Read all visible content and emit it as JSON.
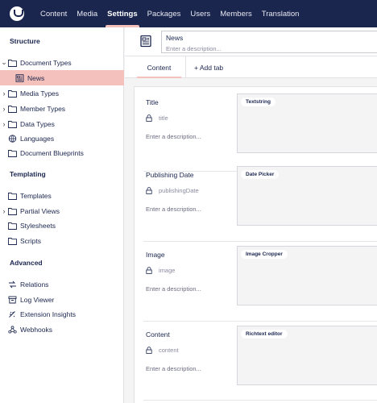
{
  "topbar": {
    "nav": [
      "Content",
      "Media",
      "Settings",
      "Packages",
      "Users",
      "Members",
      "Translation"
    ],
    "active": "Settings"
  },
  "sidebar": {
    "sections": [
      {
        "title": "Structure"
      },
      {
        "title": "Templating"
      },
      {
        "title": "Advanced"
      }
    ],
    "items": [
      {
        "label": "Document Types",
        "icon": "folder-icon",
        "caret": "expanded"
      },
      {
        "label": "News",
        "icon": "newspaper-icon",
        "active": true
      },
      {
        "label": "Media Types",
        "icon": "folder-icon",
        "caret": "collapsed"
      },
      {
        "label": "Member Types",
        "icon": "folder-icon",
        "caret": "collapsed"
      },
      {
        "label": "Data Types",
        "icon": "folder-icon",
        "caret": "collapsed"
      },
      {
        "label": "Languages",
        "icon": "globe-icon"
      },
      {
        "label": "Document Blueprints",
        "icon": "folder-icon"
      },
      {
        "label": "Templates",
        "icon": "folder-icon"
      },
      {
        "label": "Partial Views",
        "icon": "folder-icon",
        "caret": "collapsed"
      },
      {
        "label": "Stylesheets",
        "icon": "folder-icon"
      },
      {
        "label": "Scripts",
        "icon": "folder-icon"
      },
      {
        "label": "Relations",
        "icon": "relations-icon"
      },
      {
        "label": "Log Viewer",
        "icon": "box-icon"
      },
      {
        "label": "Extension Insights",
        "icon": "insights-icon"
      },
      {
        "label": "Webhooks",
        "icon": "webhook-icon"
      }
    ]
  },
  "header": {
    "icon": "newspaper-icon",
    "name_value": "News",
    "description_placeholder": "Enter a description..."
  },
  "tabs": {
    "content_label": "Content",
    "add_tab_label": "+ Add tab"
  },
  "properties": [
    {
      "label": "Title",
      "alias": "title",
      "description": "Enter a description...",
      "editor": "Textstring"
    },
    {
      "label": "Publishing Date",
      "alias": "publishingDate",
      "description": "Enter a description...",
      "editor": "Date Picker"
    },
    {
      "label": "Image",
      "alias": "image",
      "description": "Enter a description...",
      "editor": "Image Cropper"
    },
    {
      "label": "Content",
      "alias": "content",
      "description": "Enter a description...",
      "editor": "Richtext editor"
    }
  ],
  "colors": {
    "topbar": "#1b264f",
    "accent": "#f5c1bc",
    "background": "#f4f4f5"
  }
}
